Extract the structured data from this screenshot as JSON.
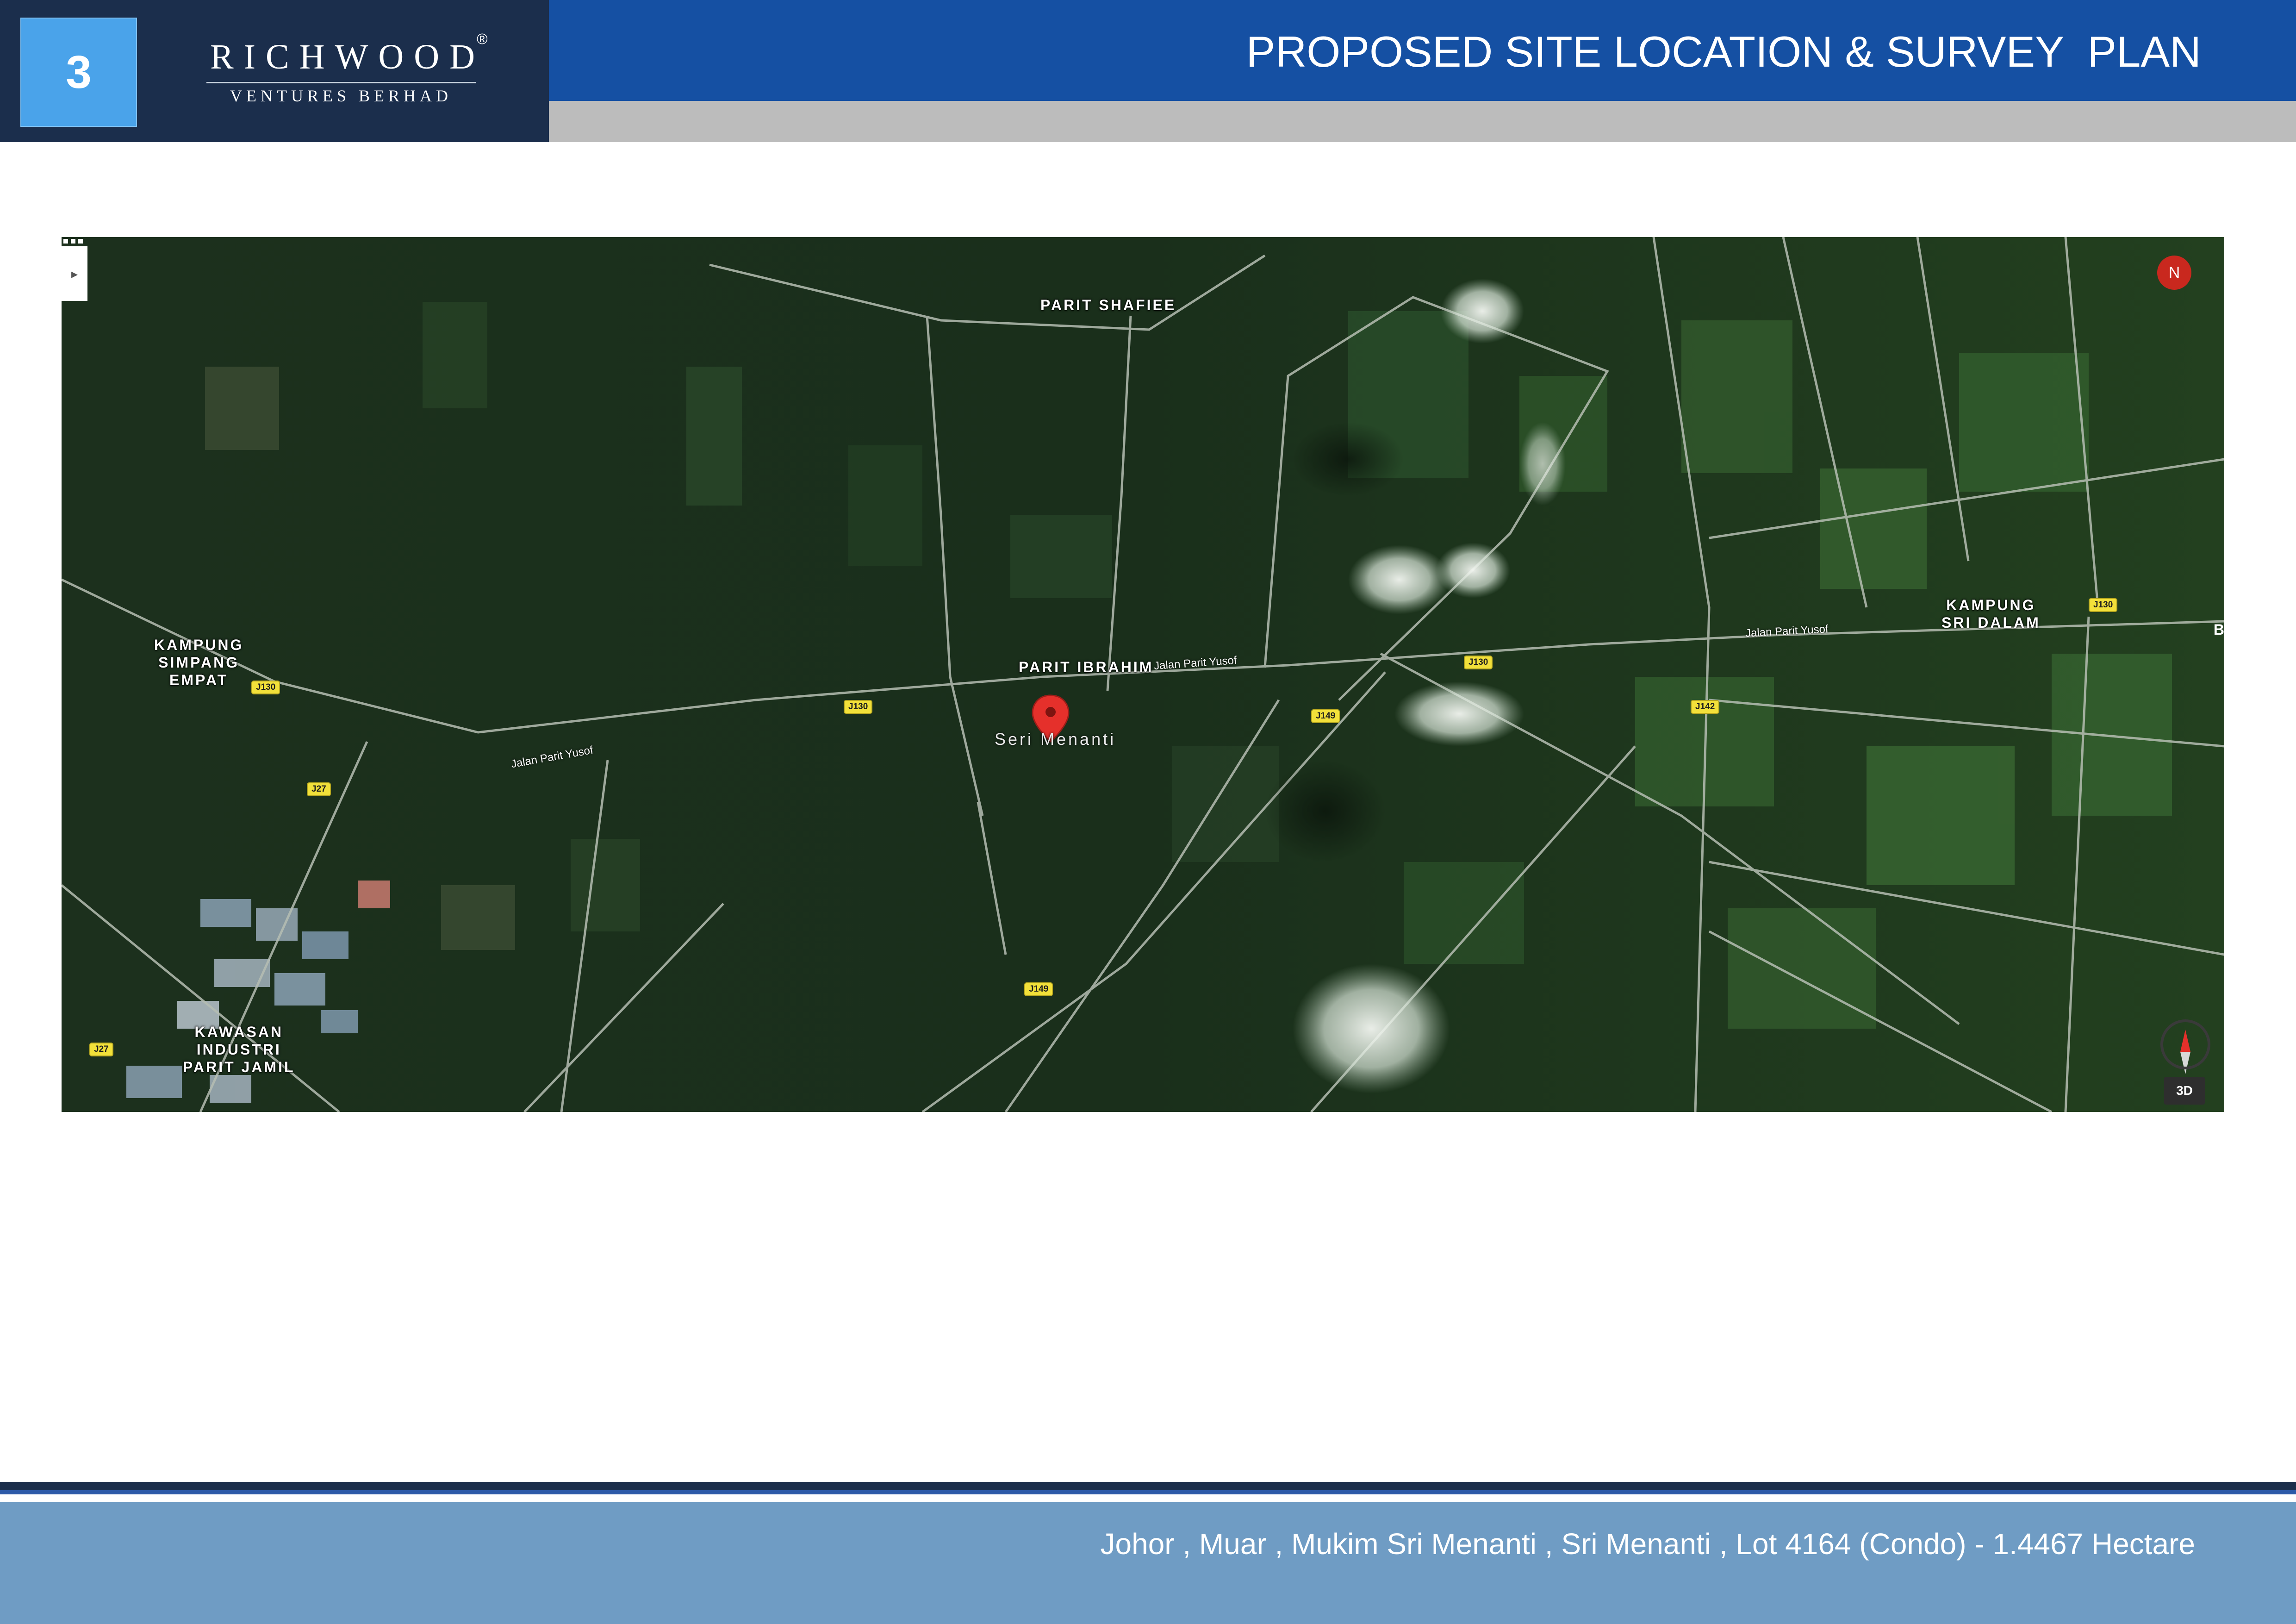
{
  "header": {
    "page_number": "3",
    "brand": {
      "name": "RICHWOOD",
      "registered_mark": "®",
      "tagline": "VENTURES BERHAD"
    },
    "title": "PROPOSED SITE LOCATION & SURVEY  PLAN"
  },
  "map": {
    "area_labels": {
      "parit_shafiee": "PARIT SHAFIEE",
      "parit_ibrahim": "PARIT IBRAHIM",
      "kampung_simpang_empat": "KAMPUNG\nSIMPANG\nEMPAT",
      "kampung_sri_dalam": "KAMPUNG\nSRI DALAM",
      "kawasan_industri": "KAWASAN\nINDUSTRI\nPARIT JAMIL",
      "edge": "B"
    },
    "marker_label": "Seri Menanti",
    "road_names": {
      "west": "Jalan Parit Yusof",
      "center": "Jalan Parit Yusof",
      "east": "Jalan Parit Yusof"
    },
    "route_shields": {
      "j130_west": "J130",
      "j130_center": "J130",
      "j130_east": "J130",
      "j130_far_east": "J130",
      "j27_north": "J27",
      "j27_south": "J27",
      "j149_north": "J149",
      "j149_south": "J149",
      "j142": "J142"
    },
    "controls": {
      "avatar_initial": "N",
      "view_3d": "3D",
      "apps_icon": "apps-grid-icon",
      "compass_icon": "compass-icon",
      "marker_icon": "map-pin-icon",
      "side_toggle_icon": "chevron-right-icon"
    },
    "colors": {
      "marker": "#e5302b",
      "avatar": "#c9281e",
      "route_shield": "#f2e03a"
    }
  },
  "footer": {
    "text": "Johor , Muar , Mukim Sri Menanti , Sri Menanti , Lot 4164 (Condo) - 1.4467 Hectare"
  },
  "colors": {
    "header_navy": "#1b2e4c",
    "header_blue": "#1550a3",
    "badge_blue": "#4aa3ea",
    "header_grey": "#bcbcbc",
    "footer_blue": "#6f9cc4"
  }
}
